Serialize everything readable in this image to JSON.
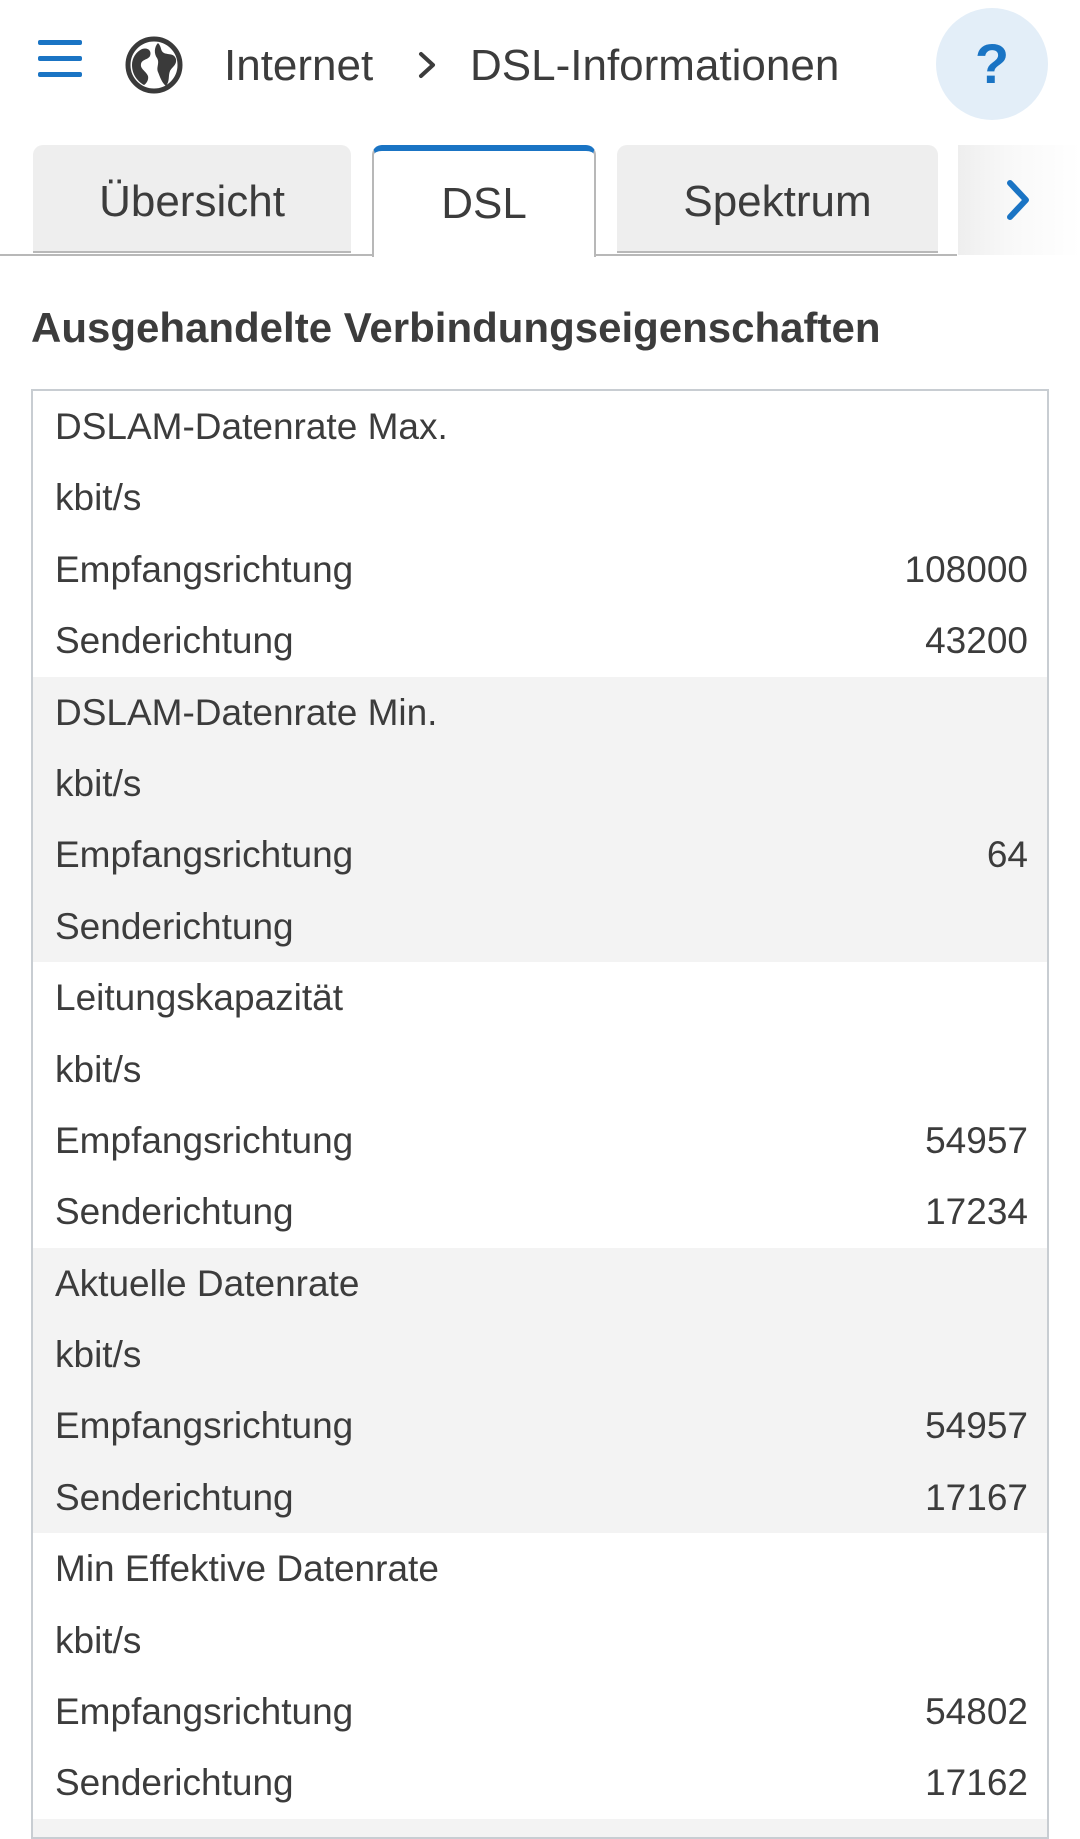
{
  "header": {
    "menu_icon": "hamburger-menu-icon",
    "globe_icon": "globe-icon",
    "breadcrumb": {
      "parent": "Internet",
      "separator_icon": "chevron-right-icon",
      "current": "DSL-Informationen"
    },
    "help_label": "?"
  },
  "tabs": [
    {
      "label": "Übersicht",
      "active": false
    },
    {
      "label": "DSL",
      "active": true
    },
    {
      "label": "Spektrum",
      "active": false
    }
  ],
  "tabs_more_icon": "chevron-right-icon",
  "accent_color": "#1a74c4",
  "section_title": "Ausgehandelte Verbindungseigenschaften",
  "groups": [
    {
      "title": "DSLAM-Datenrate Max.",
      "unit": "kbit/s",
      "rows": [
        {
          "label": "Empfangsrichtung",
          "value": "108000"
        },
        {
          "label": "Senderichtung",
          "value": "43200"
        }
      ]
    },
    {
      "title": "DSLAM-Datenrate Min.",
      "unit": "kbit/s",
      "rows": [
        {
          "label": "Empfangsrichtung",
          "value": "64"
        },
        {
          "label": "Senderichtung",
          "value": ""
        }
      ]
    },
    {
      "title": "Leitungskapazität",
      "unit": "kbit/s",
      "rows": [
        {
          "label": "Empfangsrichtung",
          "value": "54957"
        },
        {
          "label": "Senderichtung",
          "value": "17234"
        }
      ]
    },
    {
      "title": "Aktuelle Datenrate",
      "unit": "kbit/s",
      "rows": [
        {
          "label": "Empfangsrichtung",
          "value": "54957"
        },
        {
          "label": "Senderichtung",
          "value": "17167"
        }
      ]
    },
    {
      "title": "Min Effektive Datenrate",
      "unit": "kbit/s",
      "rows": [
        {
          "label": "Empfangsrichtung",
          "value": "54802"
        },
        {
          "label": "Senderichtung",
          "value": "17162"
        }
      ]
    }
  ]
}
